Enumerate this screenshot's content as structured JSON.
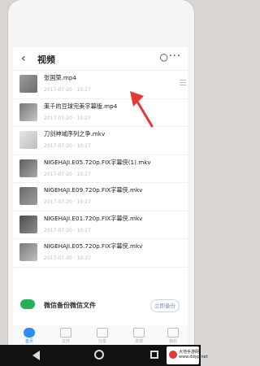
{
  "header": {
    "back_icon": "‹",
    "title": "视频",
    "search_icon": "○",
    "more_icon": "···"
  },
  "files": [
    {
      "name": "张国荣.mp4",
      "meta": "2017-07-20 · 10:27"
    },
    {
      "name": "莱千的豆球完美字幕版.mp4",
      "meta": "2017-07-20 · 10:27"
    },
    {
      "name": "刀剑神域序列之争.mkv",
      "meta": "2017-07-20 · 10:27"
    },
    {
      "name": "NIGEHAJI.E05.720p.FIX字幕侠(1).mkv",
      "meta": "2017-07-20 · 10:27"
    },
    {
      "name": "NIGEHAJI.E09.720p.FIX字幕侠.mkv",
      "meta": "2017-07-20 · 10:27"
    },
    {
      "name": "NIGEHAJI.E01.720p.FIX字幕侠.mkv",
      "meta": "2017-07-20 · 10:27"
    },
    {
      "name": "NIGEHAJI.E05.720p.FIX字幕侠.mkv",
      "meta": "2017-07-20 · 10:27"
    }
  ],
  "backup": {
    "text": "微信备份微信文件",
    "button": "立即备份"
  },
  "tabs": [
    {
      "label": "首页"
    },
    {
      "label": "文件"
    },
    {
      "label": "分享"
    },
    {
      "label": "发现"
    },
    {
      "label": "我的"
    }
  ],
  "watermark": {
    "line1": "大地手游网",
    "line2": "www.ddyp.net"
  }
}
